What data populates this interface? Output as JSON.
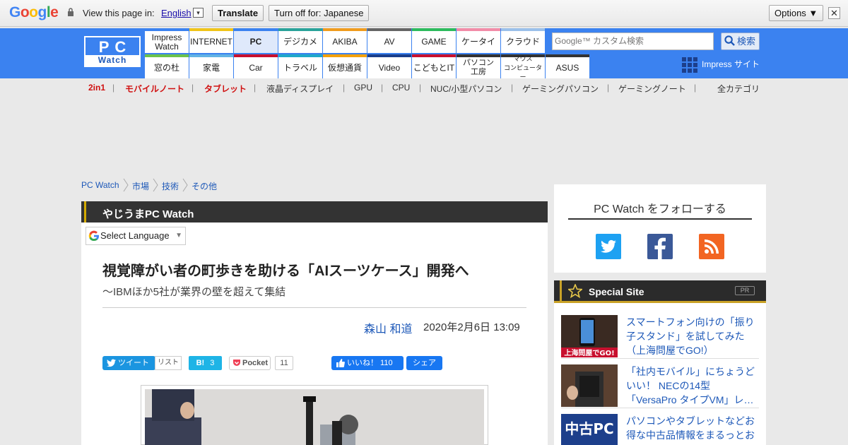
{
  "google_bar": {
    "logo": [
      "G",
      "o",
      "o",
      "g",
      "l",
      "e"
    ],
    "view_text": "View this page in:",
    "language": "English",
    "dropdown_arrow": "▾",
    "translate_label": "Translate",
    "turnoff_label": "Turn off for: Japanese",
    "options_label": "Options ▼",
    "close_label": "✕"
  },
  "header": {
    "logo_top": "PC",
    "logo_bottom": "Watch",
    "nav_top": [
      {
        "label": "Impress\nWatch",
        "color": "#3b82f0"
      },
      {
        "label": "INTERNET",
        "color": "#f0c419"
      },
      {
        "label": "PC",
        "color": "#3b82f0",
        "active": true
      },
      {
        "label": "デジカメ",
        "color": "#2aa39a"
      },
      {
        "label": "AKIBA",
        "color": "#f09c1e"
      },
      {
        "label": "AV",
        "color": "#666666"
      },
      {
        "label": "GAME",
        "color": "#2dbb5d"
      },
      {
        "label": "ケータイ",
        "color": "#f28ca8"
      },
      {
        "label": "クラウド",
        "color": "#9bc0ea"
      }
    ],
    "nav_bottom": [
      {
        "label": "窓の杜",
        "color": "#6cc24a"
      },
      {
        "label": "家電",
        "color": "#62b3e4"
      },
      {
        "label": "Car",
        "color": "#c8102e"
      },
      {
        "label": "トラベル",
        "color": "#1fa8c9"
      },
      {
        "label": "仮想通貨",
        "color": "#f3a10b"
      },
      {
        "label": "Video",
        "color": "#1b3f8b"
      },
      {
        "label": "こどもとIT",
        "color": "#c8102e"
      },
      {
        "label": "パソコン\n工房",
        "color": "#333333"
      },
      {
        "label": "マウス\nコンピューター",
        "color": "#333333"
      },
      {
        "label": "ASUS",
        "color": "#333333"
      }
    ],
    "search_placeholder": "Google™ カスタム検索",
    "search_button": "検索",
    "impress_site": "Impress サイト"
  },
  "category_nav": {
    "items": [
      {
        "label": "2in1",
        "red": true
      },
      {
        "label": "モバイルノート",
        "red": true
      },
      {
        "label": "タブレット",
        "red": true
      },
      {
        "label": "液晶ディスプレイ",
        "red": false
      },
      {
        "label": "GPU",
        "red": false
      },
      {
        "label": "CPU",
        "red": false
      },
      {
        "label": "NUC/小型パソコン",
        "red": false
      },
      {
        "label": "ゲーミングパソコン",
        "red": false
      },
      {
        "label": "ゲーミングノート",
        "red": false
      }
    ],
    "separator": "|",
    "all_categories": "全カテゴリ"
  },
  "breadcrumb": [
    "PC Watch",
    "市場",
    "技術",
    "その他"
  ],
  "article": {
    "section": "やじうまPC Watch",
    "select_language": "Select Language",
    "select_arrow": "▼",
    "title": "視覚障がい者の町歩きを助ける「AIスーツケース」開発へ",
    "subtitle": "～IBMほか5社が業界の壁を超えて集結",
    "author": "森山 和道",
    "date": "2020年2月6日 13:09",
    "share": {
      "tweet": "ツイート",
      "list": "リスト",
      "hatena_label": "B!",
      "hatena_count": "3",
      "pocket": "Pocket",
      "pocket_count": "11",
      "fb_like": "いいね！ 110",
      "fb_share": "シェア"
    }
  },
  "sidebar": {
    "follow_title": "PC Watch をフォローする",
    "special_title": "Special Site",
    "pr": "PR",
    "special_items": [
      {
        "text": "スマートフォン向けの「振り子スタンド」を試してみた（上海問屋でGO!）",
        "thumb_label": "上海問屋でGO!"
      },
      {
        "text": "「社内モバイル」にちょうどいい！ NECの14型「VersaPro タイプVM」レ…",
        "thumb_label": ""
      },
      {
        "text": "パソコンやタブレットなどお得な中古品情報をまるっとお",
        "thumb_label": "中古PC"
      }
    ]
  }
}
